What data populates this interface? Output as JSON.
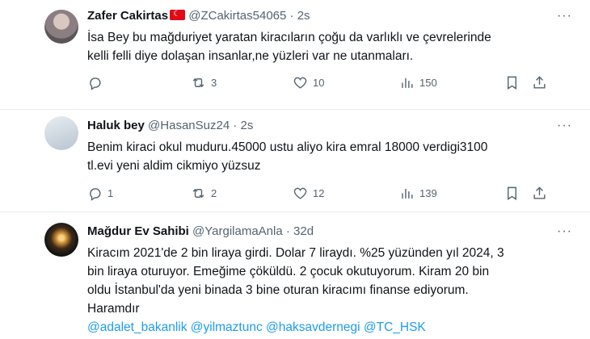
{
  "tweets": [
    {
      "name": "Zafer Cakirtas",
      "handle": "@ZCakirtas54065",
      "dot": "·",
      "time": "2s",
      "lines": [
        "İsa Bey bu mağduriyet yaratan kiracıların çoğu da varlıklı ve çevrelerinde",
        "kelli felli diye dolaşan insanlar,ne yüzleri var ne utanmaları."
      ],
      "replies": "",
      "retweets": "3",
      "likes": "10",
      "views": "150"
    },
    {
      "name": "Haluk bey",
      "handle": "@HasanSuz24",
      "dot": "·",
      "time": "2s",
      "lines": [
        "Benim kiraci okul muduru.45000 ustu aliyo kira emral 18000 verdigi3100",
        "tl.evi yeni aldim cikmiyo yüzsuz"
      ],
      "replies": "1",
      "retweets": "2",
      "likes": "12",
      "views": "139"
    },
    {
      "name": "Mağdur Ev Sahibi",
      "handle": "@YargilamaAnla",
      "dot": "·",
      "time": "32d",
      "lines": [
        "Kiracım 2021'de 2 bin liraya girdi. Dolar 7 liraydı. %25 yüzünden yıl 2024, 3",
        "bin liraya oturuyor. Emeğime çöküldü. 2 çocuk okutuyorum. Kiram 20 bin",
        "oldu İstanbul'da yeni binada 3 bine oturan kiracımı finanse ediyorum.",
        "Haramdır"
      ],
      "mentions": "@adalet_bakanlik @yilmaztunc @haksavdernegi @TC_HSK"
    }
  ],
  "more_glyph": "···",
  "colors": {
    "link": "#1d9bf0",
    "muted": "#536471",
    "text": "#0f1419"
  }
}
